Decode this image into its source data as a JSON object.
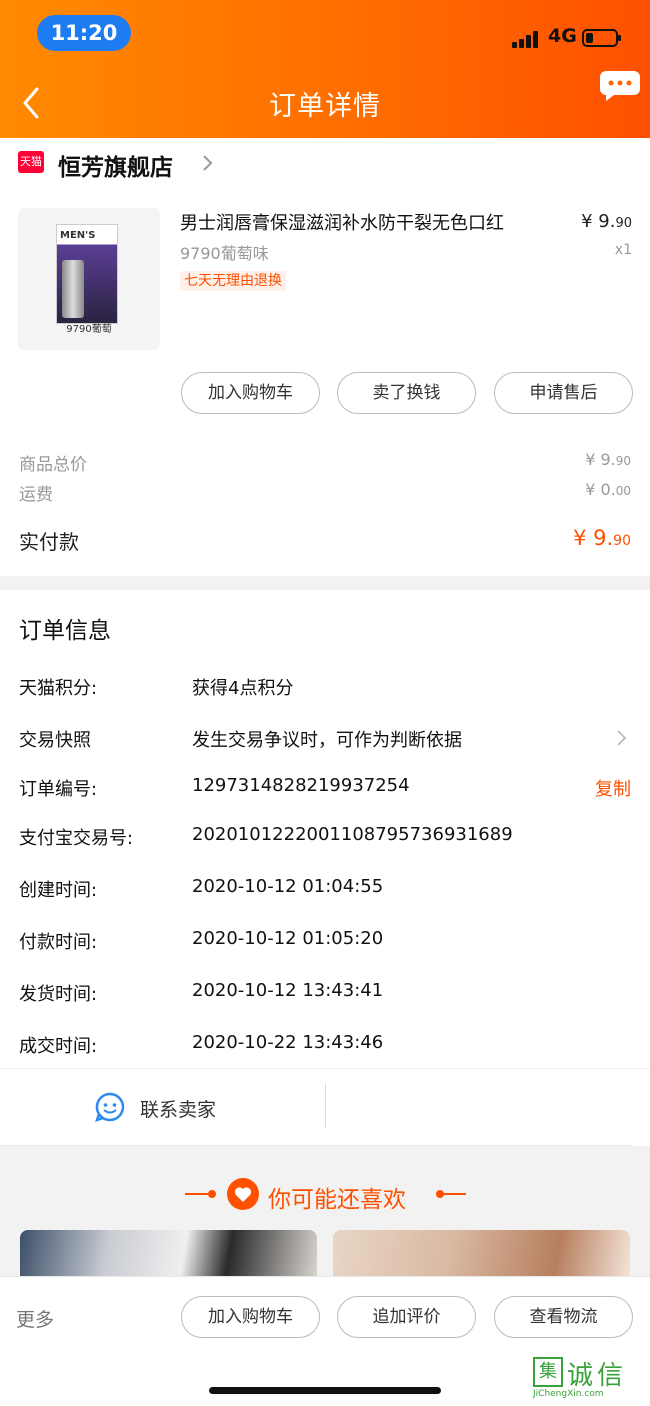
{
  "status_bar": {
    "time": "11:20",
    "network": "4G"
  },
  "header": {
    "title": "订单详情"
  },
  "store": {
    "logo_text": "天猫",
    "name": "恒芳旗舰店"
  },
  "product": {
    "name": "男士润唇膏保湿滋润补水防干裂无色口红",
    "price_main": "¥ 9.",
    "price_cents": "90",
    "variant": "9790葡萄味",
    "quantity": "x1",
    "tag": "七天无理由退换",
    "thumb_brand": "MEN'S",
    "thumb_caption": "9790葡萄"
  },
  "actions": [
    "加入购物车",
    "卖了换钱",
    "申请售后"
  ],
  "fees": {
    "goods_label": "商品总价",
    "goods_main": "¥ 9.",
    "goods_cents": "90",
    "shipping_label": "运费",
    "shipping_main": "¥ 0.",
    "shipping_cents": "00",
    "paid_label": "实付款",
    "paid_main": "¥ 9.",
    "paid_cents": "90"
  },
  "order_info": {
    "title": "订单信息",
    "rows": [
      {
        "label": "天猫积分:",
        "value": "获得4点积分"
      },
      {
        "label": "交易快照",
        "value": "发生交易争议时，可作为判断依据"
      },
      {
        "label": "订单编号:",
        "value": "1297314828219937254",
        "action": "复制"
      },
      {
        "label": "支付宝交易号:",
        "value": "2020101222001108795736931689"
      },
      {
        "label": "创建时间:",
        "value": "2020-10-12 01:04:55"
      },
      {
        "label": "付款时间:",
        "value": "2020-10-12 01:05:20"
      },
      {
        "label": "发货时间:",
        "value": "2020-10-12 13:43:41"
      },
      {
        "label": "成交时间:",
        "value": "2020-10-22 13:43:46"
      }
    ]
  },
  "contact": {
    "label": "联系卖家"
  },
  "recommend": {
    "title": "你可能还喜欢"
  },
  "bottom_bar": {
    "more": "更多",
    "buttons": [
      "加入购物车",
      "追加评价",
      "查看物流"
    ]
  },
  "watermark": {
    "char": "集",
    "text": "诚信",
    "url": "JiChengXin.com"
  },
  "colors": {
    "accent": "#ff5000",
    "header_start": "#ff8a00",
    "tmall_red": "#ff0036",
    "watermark_green": "#3aa23a"
  }
}
